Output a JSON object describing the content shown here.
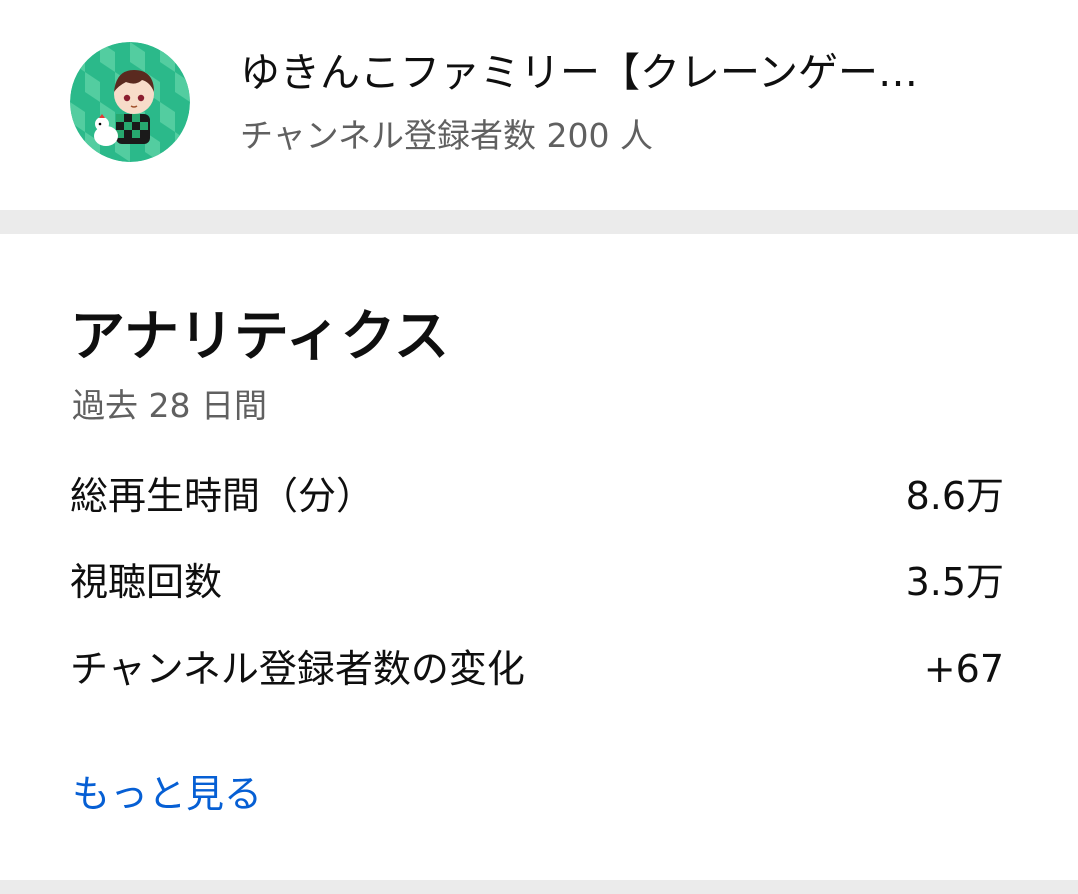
{
  "channel": {
    "name": "ゆきんこファミリー【クレーンゲー…",
    "subscriber_label": "チャンネル登録者数",
    "subscriber_count": "200 人"
  },
  "analytics": {
    "title": "アナリティクス",
    "period": "過去 28 日間",
    "metrics": [
      {
        "label": "総再生時間（分）",
        "value": "8.6万"
      },
      {
        "label": "視聴回数",
        "value": "3.5万"
      },
      {
        "label": "チャンネル登録者数の変化",
        "value": "+67"
      }
    ],
    "more_link": "もっと見る"
  },
  "colors": {
    "primary_text": "#0f0f0f",
    "secondary_text": "#606060",
    "link": "#065fd4",
    "divider": "#ebebeb",
    "avatar_bg": "#2bb98a"
  },
  "icons": {
    "avatar": "channel-avatar-image"
  }
}
